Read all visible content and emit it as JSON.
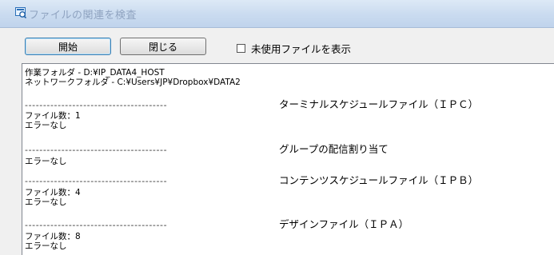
{
  "window": {
    "title": "ファイルの関連を検査"
  },
  "toolbar": {
    "start_label": "開始",
    "close_label": "閉じる",
    "show_unused_label": "未使用ファイルを表示",
    "show_unused_checked": false
  },
  "log": {
    "work_folder": "作業フォルダ - D:¥IP_DATA4_HOST",
    "network_folder": "ネットワークフォルダ - C:¥Users¥JP¥Dropbox¥DATA2",
    "sections": [
      {
        "divider": "---------------------------------------",
        "heading": "ターミナルスケジュールファイル（ＩＰＣ）",
        "count": "ファイル数：1",
        "status": "エラーなし"
      },
      {
        "divider": "---------------------------------------",
        "heading": "グループの配信割り当て",
        "status": "エラーなし"
      },
      {
        "divider": "---------------------------------------",
        "heading": "コンテンツスケジュールファイル（ＩＰＢ）",
        "count": "ファイル数：4",
        "status": "エラーなし"
      },
      {
        "divider": "---------------------------------------",
        "heading": "デザインファイル（ＩＰＡ）",
        "count": "ファイル数：8",
        "status": "エラーなし"
      }
    ]
  }
}
